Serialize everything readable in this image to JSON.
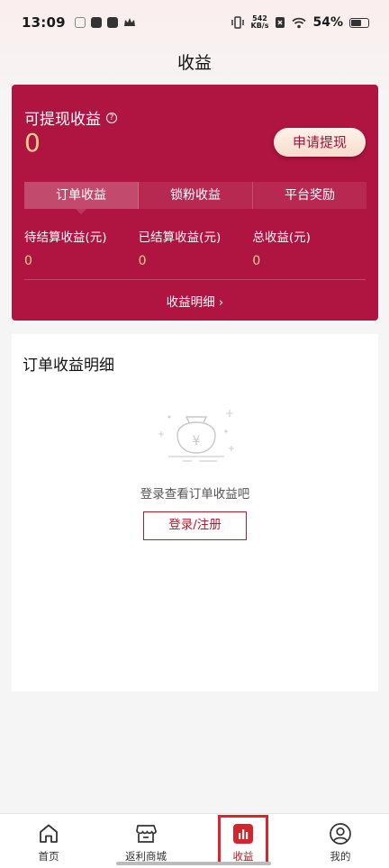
{
  "status_bar": {
    "time": "13:09",
    "net_speed_value": "542",
    "net_speed_unit": "KB/s",
    "battery": "54%"
  },
  "page_title": "收益",
  "earnings": {
    "withdrawable_label": "可提现收益",
    "withdrawable_amount": "0",
    "apply_button": "申请提现",
    "tabs": [
      {
        "label": "订单收益"
      },
      {
        "label": "锁粉收益"
      },
      {
        "label": "平台奖励"
      }
    ],
    "stats": [
      {
        "label": "待结算收益(元)",
        "value": "0"
      },
      {
        "label": "已结算收益(元)",
        "value": "0"
      },
      {
        "label": "总收益(元)",
        "value": "0"
      }
    ],
    "detail_link": "收益明细 ›"
  },
  "order_detail": {
    "title": "订单收益明细",
    "empty_text": "登录查看订单收益吧",
    "login_button": "登录/注册"
  },
  "bottom_nav": [
    {
      "label": "首页",
      "icon": "home-icon"
    },
    {
      "label": "返利商城",
      "icon": "store-icon"
    },
    {
      "label": "收益",
      "icon": "earnings-icon"
    },
    {
      "label": "我的",
      "icon": "profile-icon"
    }
  ],
  "colors": {
    "brand": "#b01440",
    "amount": "#f9d28d",
    "nav_active": "#c0151c"
  }
}
